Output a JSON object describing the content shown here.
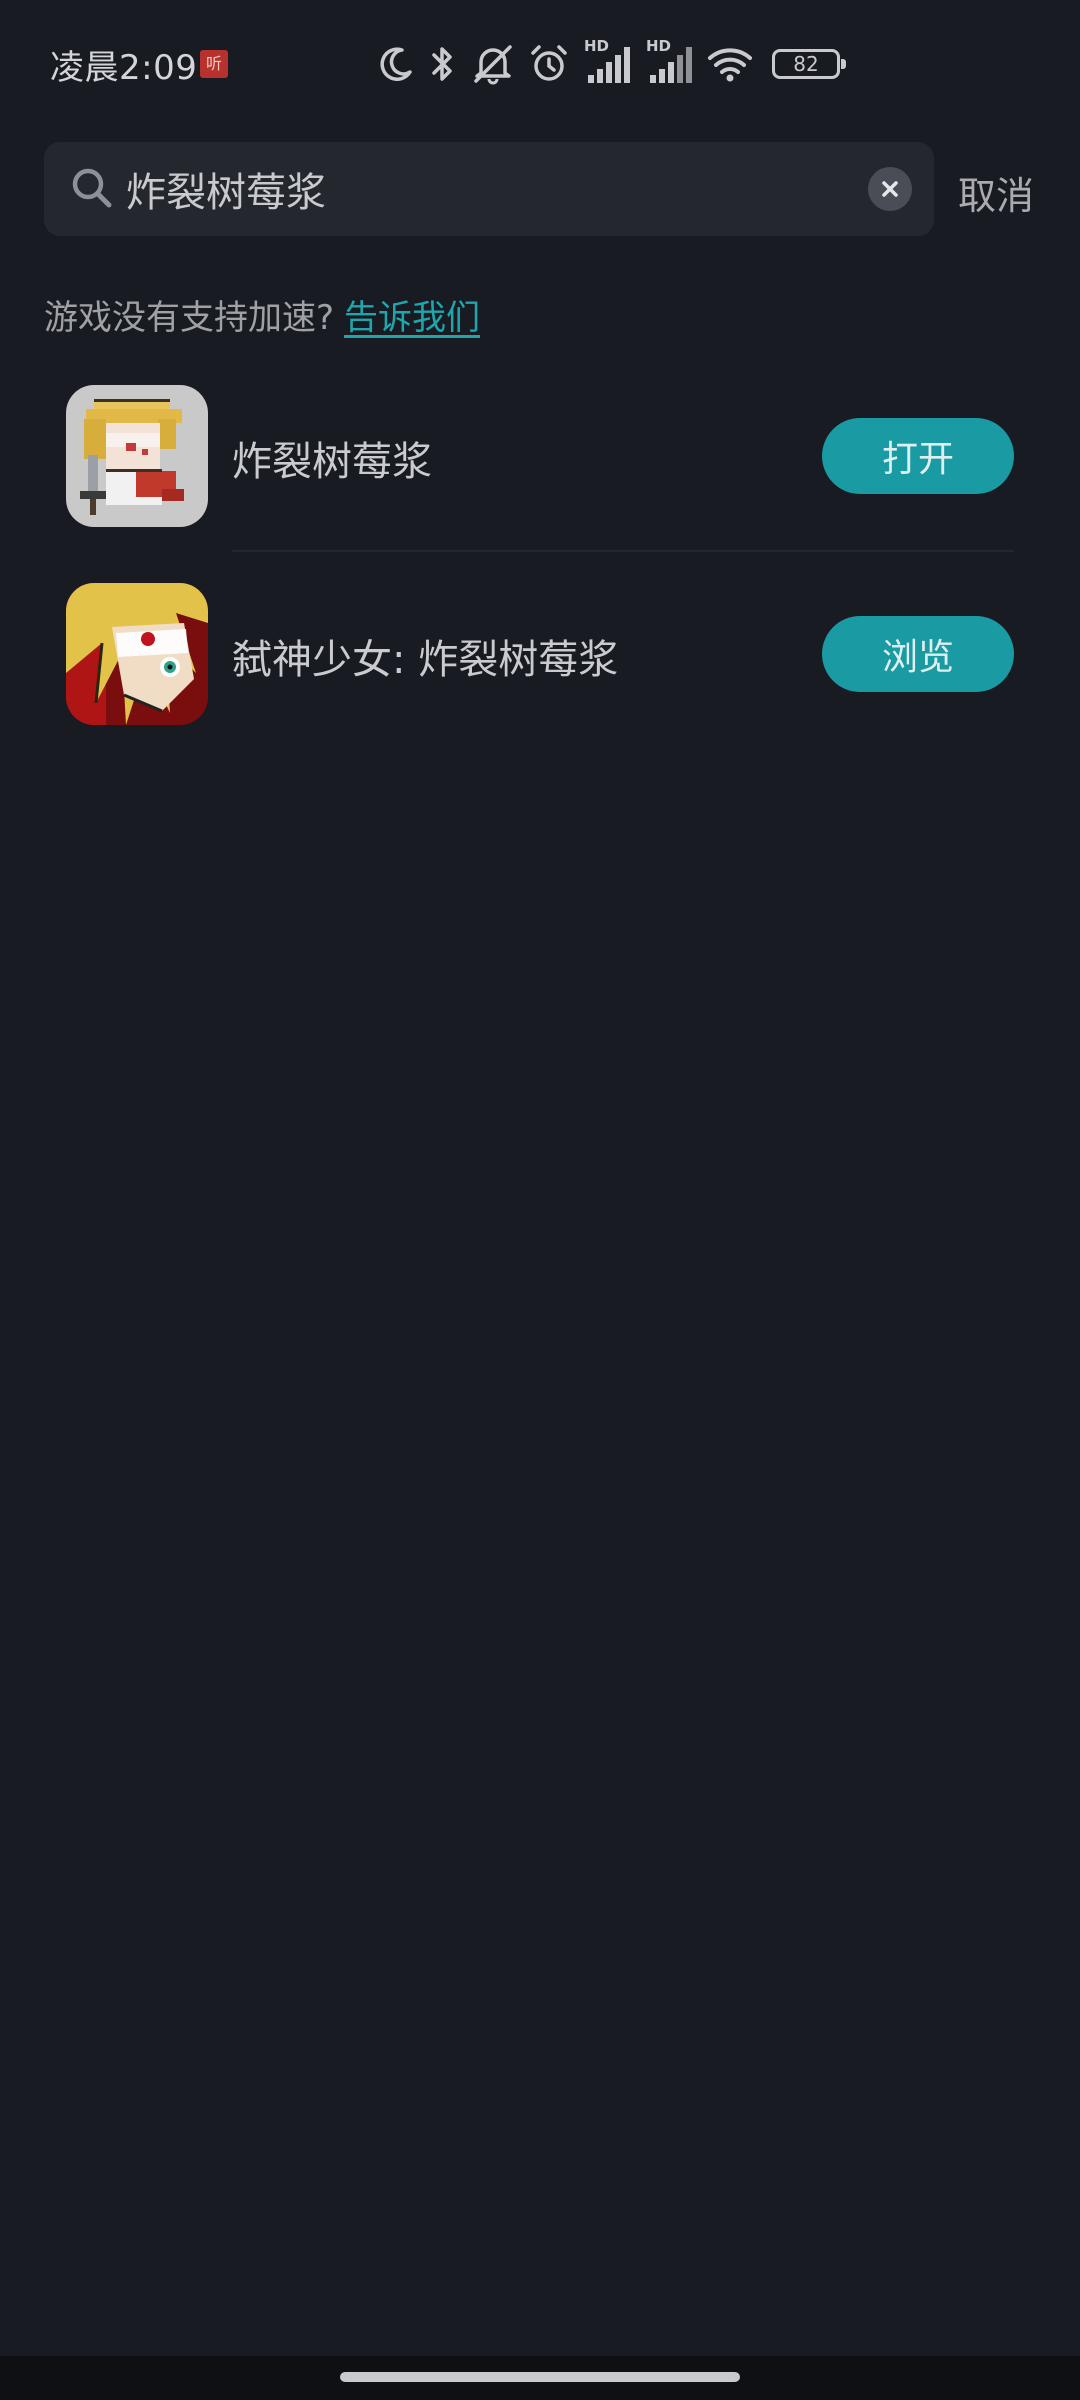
{
  "status_bar": {
    "time": "凌晨2:09",
    "notification_badge": "听",
    "icons": [
      "moon-icon",
      "bluetooth-icon",
      "mute-icon",
      "alarm-icon",
      "signal-icon",
      "signal-icon",
      "wifi-icon"
    ],
    "hd_label_1": "HD",
    "hd_label_2": "HD",
    "battery": "82"
  },
  "search": {
    "value": "炸裂树莓浆",
    "placeholder": "",
    "cancel_label": "取消"
  },
  "hint": {
    "text": "游戏没有支持加速?",
    "link": "告诉我们"
  },
  "results": [
    {
      "title": "炸裂树莓浆",
      "button": "打开"
    },
    {
      "title": "弑神少女: 炸裂树莓浆",
      "button": "浏览"
    }
  ],
  "colors": {
    "background": "#191b22",
    "accent": "#1a9aa2",
    "link": "#1fa6ad"
  }
}
